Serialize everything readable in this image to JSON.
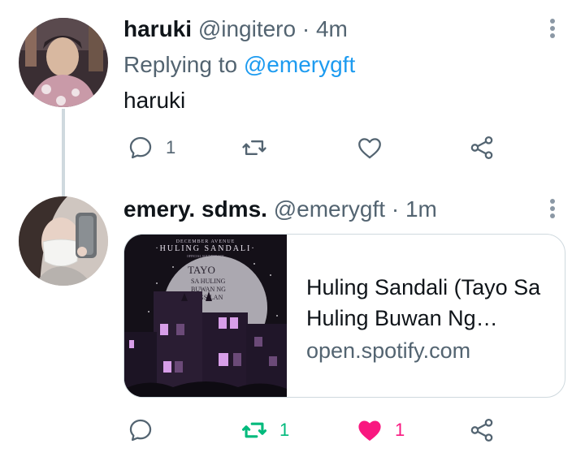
{
  "tweets": [
    {
      "display_name": "haruki",
      "handle": "@ingitero",
      "time": "4m",
      "replying_prefix": "Replying to",
      "replying_handle": "@emerygft",
      "text": "haruki",
      "reply_count": "1",
      "retweet_count": "",
      "like_count": "",
      "liked": false,
      "retweeted": false
    },
    {
      "display_name": "emery. sdms.",
      "handle": "@emerygft",
      "time": "1m",
      "card": {
        "title": "Huling Sandali (Tayo Sa Huling Buwan Ng…",
        "domain": "open.spotify.com",
        "art_top_text": "DECEMBER AVENUE",
        "art_band_text": "·HULING SANDALI·",
        "art_small_text": "OFFICIAL SOUNDTRACK",
        "art_logo_line1": "TAYO",
        "art_logo_line2": "SA HULING",
        "art_logo_line3": "BUWAN NG",
        "art_logo_line4": "TAGSILAN"
      },
      "reply_count": "",
      "retweet_count": "1",
      "like_count": "1",
      "liked": true,
      "retweeted": true
    }
  ],
  "separator": "·",
  "colors": {
    "link": "#1d9bf0",
    "muted": "#536471",
    "retweet_green": "#00ba7c",
    "like_pink": "#f91880"
  },
  "icons": [
    "reply-icon",
    "retweet-icon",
    "heart-icon",
    "share-icon",
    "more-icon"
  ]
}
